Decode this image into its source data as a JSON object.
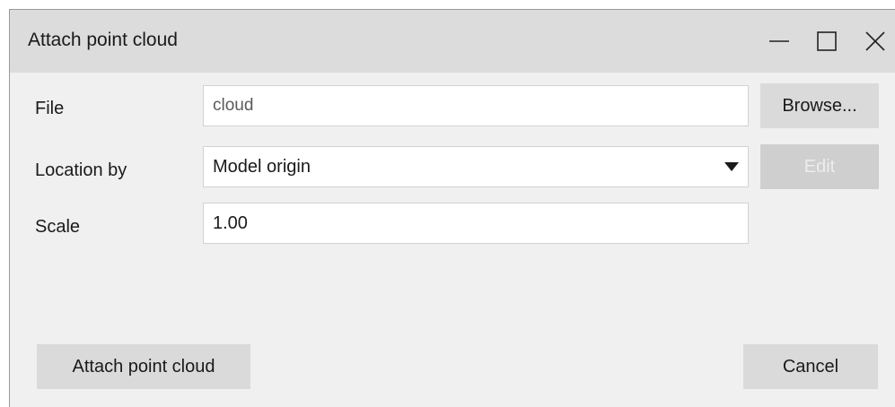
{
  "window": {
    "title": "Attach point cloud",
    "controls": {
      "minimize_icon": "minimize-icon",
      "maximize_icon": "maximize-icon",
      "close_icon": "close-icon"
    }
  },
  "form": {
    "file": {
      "label": "File",
      "value": "cloud",
      "browse_label": "Browse..."
    },
    "location": {
      "label": "Location by",
      "selected": "Model origin",
      "edit_label": "Edit"
    },
    "scale": {
      "label": "Scale",
      "value": "1.00"
    }
  },
  "footer": {
    "attach_label": "Attach point cloud",
    "cancel_label": "Cancel"
  },
  "colors": {
    "titlebar": "#dcdcdc",
    "background": "#f0f0f0",
    "button": "#dadada",
    "disabled_text": "#ededed"
  }
}
